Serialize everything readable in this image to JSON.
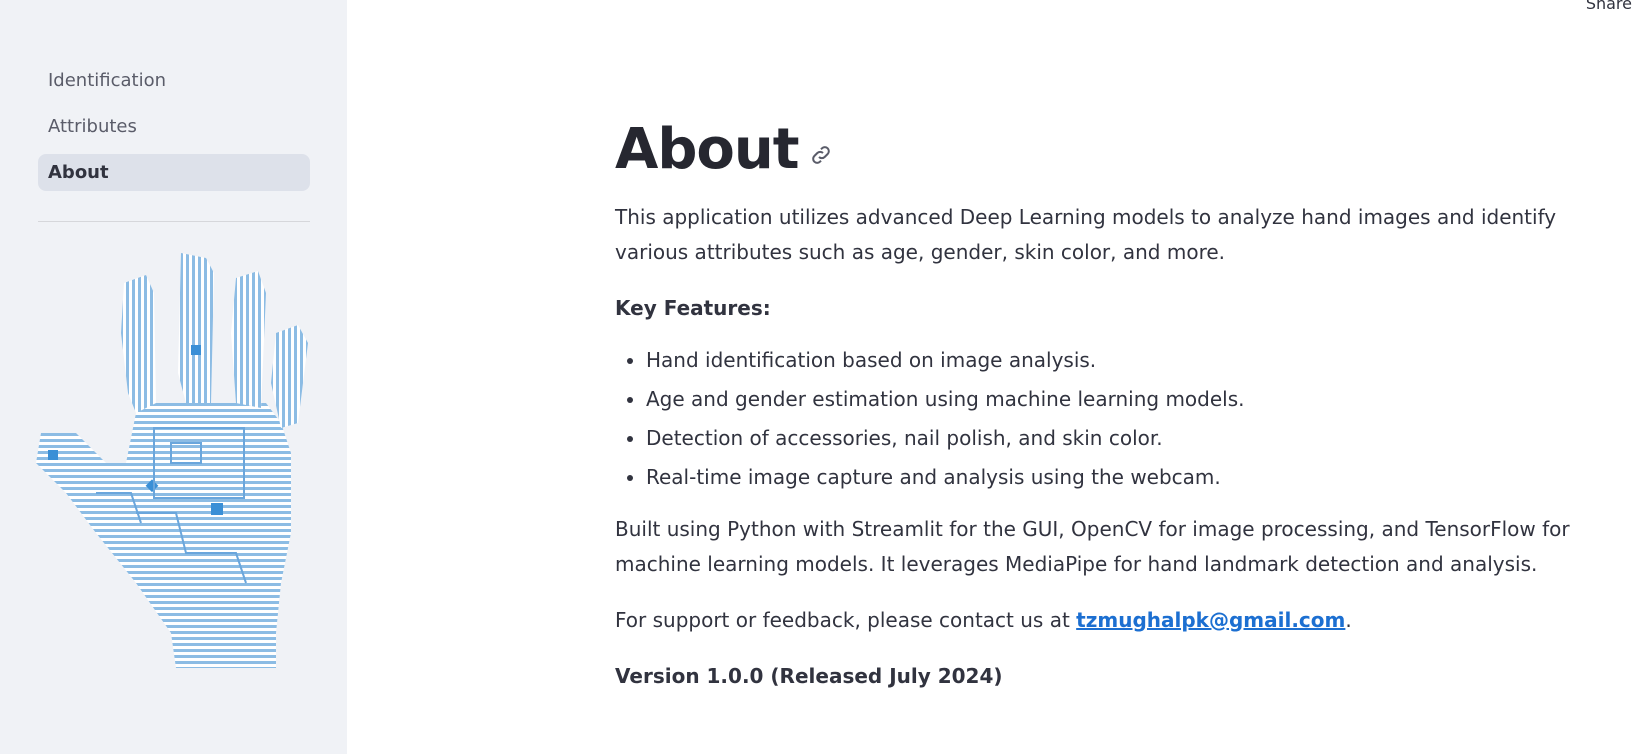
{
  "header": {
    "share_label": "Share"
  },
  "sidebar": {
    "items": [
      {
        "label": "Identification",
        "active": false
      },
      {
        "label": "Attributes",
        "active": false
      },
      {
        "label": "About",
        "active": true
      }
    ],
    "image": "circuit-hand-illustration"
  },
  "main": {
    "title": "About",
    "intro": "This application utilizes advanced Deep Learning models to analyze hand images and identify various attributes such as age, gender, skin color, and more.",
    "features_label": "Key Features:",
    "features": [
      "Hand identification based on image analysis.",
      "Age and gender estimation using machine learning models.",
      "Detection of accessories, nail polish, and skin color.",
      "Real-time image capture and analysis using the webcam."
    ],
    "built_with": "Built using Python with Streamlit for the GUI, OpenCV for image processing, and TensorFlow for machine learning models. It leverages MediaPipe for hand landmark detection and analysis.",
    "support_prefix": "For support or feedback, please contact us at ",
    "support_email": "tzmughalpk@gmail.com",
    "support_suffix": ".",
    "version": "Version 1.0.0 (Released July 2024)"
  },
  "colors": {
    "sidebar_bg": "#f0f2f6",
    "active_nav_bg": "#dde1ea",
    "link": "#1c6fd1",
    "hand_blue": "#7fb3e0"
  }
}
